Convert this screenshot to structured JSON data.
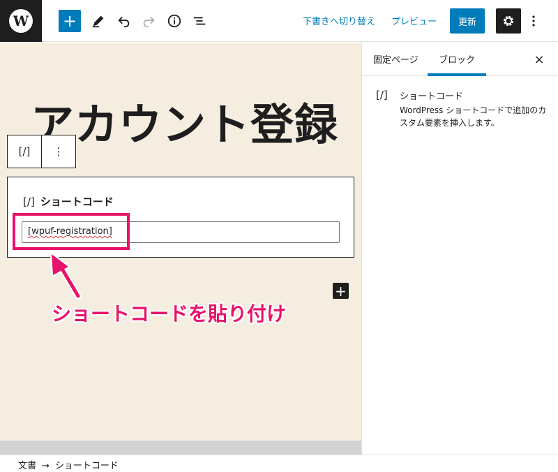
{
  "topbar": {
    "add_label": "+",
    "draft_switch": "下書きへ切り替え",
    "preview": "プレビュー",
    "update": "更新"
  },
  "editor": {
    "title": "アカウント登録",
    "block_toolbar": {
      "shortcode_icon": "[/]",
      "options_icon": "⋮"
    },
    "shortcode_block": {
      "icon": "[/]",
      "label": "ショートコード",
      "value": "[wpuf-registration]"
    },
    "inserter_label": "+",
    "annotation": "ショートコードを貼り付け"
  },
  "sidebar": {
    "tabs": [
      "固定ページ",
      "ブロック"
    ],
    "active_tab": "ブロック",
    "close": "×",
    "block": {
      "icon": "[/]",
      "name": "ショートコード",
      "description": "WordPress ショートコードで追加のカスタム要素を挿入します。"
    }
  },
  "breadcrumb": {
    "items": [
      "文書",
      "ショートコード"
    ],
    "separator": "→"
  },
  "colors": {
    "accent": "#007cba",
    "annotation": "#e8136a",
    "canvas_bg": "#f5eee0",
    "dark": "#1e1e1e"
  },
  "icons": {
    "logo": "wordpress-logo-icon",
    "edit": "pencil-icon",
    "undo": "undo-icon",
    "redo": "redo-icon",
    "info": "info-icon",
    "outline": "list-view-icon",
    "settings": "gear-icon",
    "more": "more-vertical-icon"
  }
}
